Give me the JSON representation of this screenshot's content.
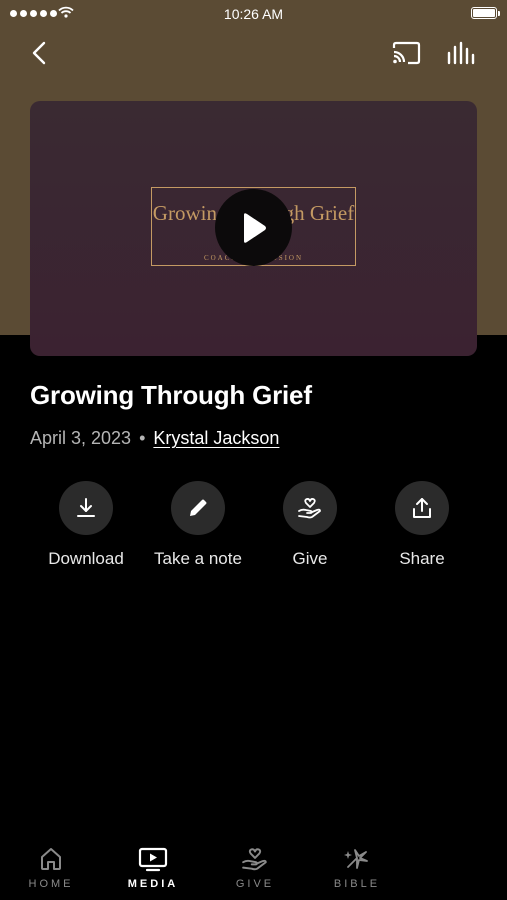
{
  "status_bar": {
    "time": "10:26 AM"
  },
  "video": {
    "thumbnail_title": "Growing Through Grief",
    "thumbnail_subtitle": "COACHING SESSION"
  },
  "content": {
    "title": "Growing Through Grief",
    "date": "April 3, 2023",
    "separator": "•",
    "author": "Krystal Jackson"
  },
  "actions": [
    {
      "label": "Download",
      "icon": "download-icon"
    },
    {
      "label": "Take a note",
      "icon": "pencil-icon"
    },
    {
      "label": "Give",
      "icon": "give-hand-heart-icon"
    },
    {
      "label": "Share",
      "icon": "share-icon"
    }
  ],
  "tabs": [
    {
      "label": "HOME",
      "icon": "home-icon",
      "active": false
    },
    {
      "label": "MEDIA",
      "icon": "tv-play-icon",
      "active": true
    },
    {
      "label": "GIVE",
      "icon": "give-hand-heart-icon",
      "active": false
    },
    {
      "label": "BIBLE",
      "icon": "bible-sparkle-icon",
      "active": false
    }
  ],
  "colors": {
    "header_bg": "#5b4b34",
    "video_bg": "#3b2231",
    "thumbnail_accent": "#c49a63",
    "action_circle": "#2b2b2b",
    "inactive_tab": "#8a8a8a"
  }
}
